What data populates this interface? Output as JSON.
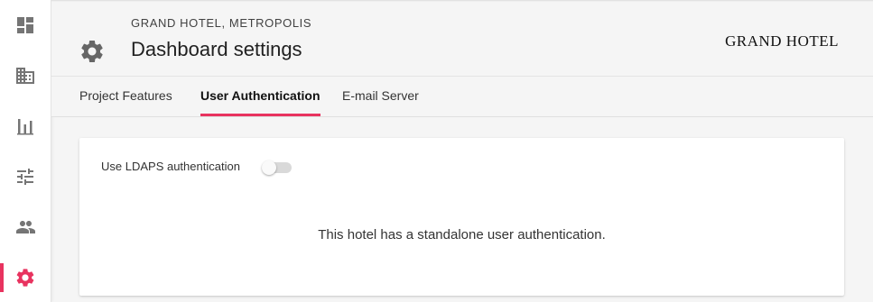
{
  "sidebar": {
    "items": [
      {
        "icon": "dashboard-icon",
        "active": false
      },
      {
        "icon": "building-icon",
        "active": false
      },
      {
        "icon": "bar-chart-icon",
        "active": false
      },
      {
        "icon": "sliders-icon",
        "active": false
      },
      {
        "icon": "users-icon",
        "active": false
      },
      {
        "icon": "gear-icon",
        "active": true
      }
    ]
  },
  "header": {
    "hotel_name": "GRAND HOTEL, METROPOLIS",
    "title": "Dashboard settings",
    "title_icon": "gear-icon",
    "logo_text": "GRAND HOTEL"
  },
  "tabs": [
    {
      "label": "Project Features",
      "active": false
    },
    {
      "label": "User Authentication",
      "active": true
    },
    {
      "label": "E-mail Server",
      "active": false
    }
  ],
  "card": {
    "ldaps_label": "Use LDAPS authentication",
    "ldaps_enabled": false,
    "message": "This hotel has a standalone user authentication."
  },
  "colors": {
    "accent": "#e8335f",
    "icon_gray": "#757575",
    "background": "#f5f5f5"
  }
}
